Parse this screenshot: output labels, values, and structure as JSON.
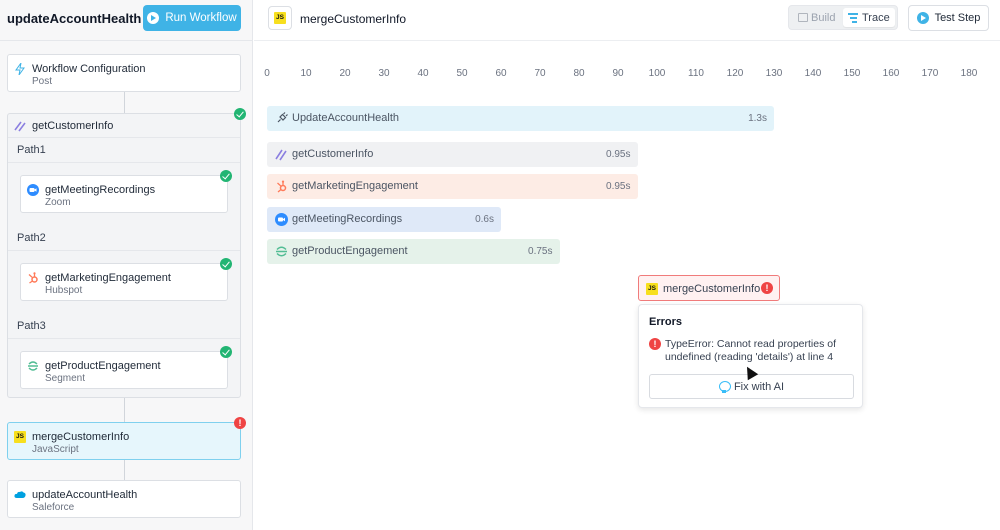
{
  "sidebar": {
    "workflow_name": "updateAccountHealth",
    "run_button": "Run Workflow",
    "config": {
      "title": "Workflow Configuration",
      "subtitle": "Post"
    },
    "group": {
      "title": "getCustomerInfo",
      "paths": [
        {
          "label": "Path1",
          "step": {
            "title": "getMeetingRecordings",
            "subtitle": "Zoom"
          }
        },
        {
          "label": "Path2",
          "step": {
            "title": "getMarketingEngagement",
            "subtitle": "Hubspot"
          }
        },
        {
          "label": "Path3",
          "step": {
            "title": "getProductEngagement",
            "subtitle": "Segment"
          }
        }
      ]
    },
    "merge_step": {
      "title": "mergeCustomerInfo",
      "subtitle": "JavaScript",
      "icon_text": "JS"
    },
    "final_step": {
      "title": "updateAccountHealth",
      "subtitle": "Saleforce"
    }
  },
  "header": {
    "step_name": "mergeCustomerInfo",
    "step_icon_text": "JS",
    "toggle": {
      "build": "Build",
      "trace": "Trace",
      "active": "Trace"
    },
    "test_button": "Test Step"
  },
  "timeline": {
    "ticks": [
      "0",
      "10",
      "20",
      "30",
      "40",
      "50",
      "60",
      "70",
      "80",
      "90",
      "100",
      "110",
      "120",
      "130",
      "140",
      "150",
      "160",
      "170",
      "180"
    ],
    "bars": [
      {
        "label": "UpdateAccountHealth",
        "duration": "1.3s",
        "start": 0,
        "end": 130,
        "color": "#e2f3fa",
        "icon": "plug-icon"
      },
      {
        "label": "getCustomerInfo",
        "duration": "0.95s",
        "start": 0,
        "end": 95,
        "color": "#f0f1f3",
        "icon": "paths-icon"
      },
      {
        "label": "getMarketingEngagement",
        "duration": "0.95s",
        "start": 0,
        "end": 95,
        "color": "#fdece5",
        "icon": "hubspot-icon"
      },
      {
        "label": "getMeetingRecordings",
        "duration": "0.6s",
        "start": 0,
        "end": 60,
        "color": "#dfe9f8",
        "icon": "zoom-icon"
      },
      {
        "label": "getProductEngagement",
        "duration": "0.75s",
        "start": 0,
        "end": 75,
        "color": "#e5f2ea",
        "icon": "segment-icon"
      }
    ],
    "error_node": {
      "label": "mergeCustomerInfo",
      "icon_text": "JS"
    }
  },
  "error_popup": {
    "heading": "Errors",
    "message": "TypeError: Cannot read properties of undefined (reading 'details') at line 4",
    "fix_button": "Fix with AI"
  },
  "colors": {
    "accent": "#3fb3e6",
    "success": "#22b573",
    "error": "#ef4444"
  }
}
